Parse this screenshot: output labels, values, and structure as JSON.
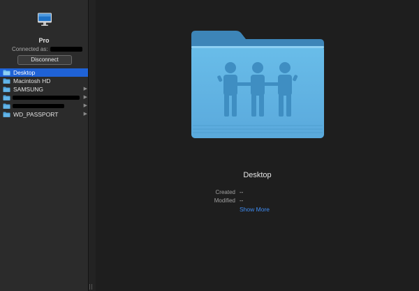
{
  "server": {
    "icon": "imac-server-icon",
    "name": "Pro",
    "connected_label": "Connected as:",
    "disconnect_label": "Disconnect"
  },
  "sidebar": {
    "items": [
      {
        "label": "Desktop",
        "selected": true,
        "chevron": false
      },
      {
        "label": "Macintosh HD",
        "selected": false,
        "chevron": false
      },
      {
        "label": "SAMSUNG",
        "selected": false,
        "chevron": true
      },
      {
        "label": "",
        "redacted": true,
        "selected": false,
        "chevron": true
      },
      {
        "label": "",
        "redacted": true,
        "selected": false,
        "chevron": true
      },
      {
        "label": "WD_PASSPORT",
        "selected": false,
        "chevron": true
      }
    ]
  },
  "preview": {
    "icon": "shared-folder-icon",
    "title": "Desktop",
    "created_label": "Created",
    "created_value": "--",
    "modified_label": "Modified",
    "modified_value": "--",
    "show_more": "Show More"
  },
  "colors": {
    "selection": "#1f62d6",
    "folder": "#5fb4e6",
    "link": "#3f8cf2"
  }
}
